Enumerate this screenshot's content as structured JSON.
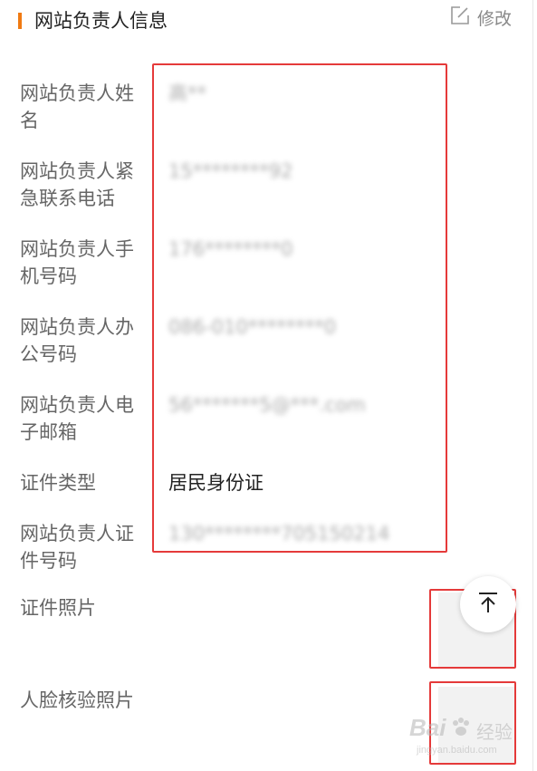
{
  "header": {
    "title": "网站负责人信息",
    "edit_label": "修改",
    "accent_color": "#f07a12",
    "edit_icon": "edit-icon"
  },
  "fields": [
    {
      "label": "网站负责人姓名",
      "value": "高**",
      "blurred": true
    },
    {
      "label": "网站负责人紧急联系电话",
      "value": "15********92",
      "blurred": true
    },
    {
      "label": "网站负责人手机号码",
      "value": "176********0",
      "blurred": true
    },
    {
      "label": "网站负责人办公号码",
      "value": "086-010********0",
      "blurred": true
    },
    {
      "label": "网站负责人电子邮箱",
      "value": "56*******5@***.com",
      "blurred": true
    },
    {
      "label": "证件类型",
      "value": "居民身份证",
      "blurred": false
    },
    {
      "label": "网站负责人证件号码",
      "value": "130********705150214",
      "blurred": true
    }
  ],
  "photos": [
    {
      "label": "证件照片"
    },
    {
      "label": "人脸核验照片"
    }
  ],
  "controls": {
    "back_to_top_icon": "arrow-up-to-top-icon"
  },
  "highlight_color": "#e53a3a",
  "watermark": {
    "brand": "Bai",
    "brand_suffix": "经验",
    "url": "jingyan.baidu.com"
  }
}
